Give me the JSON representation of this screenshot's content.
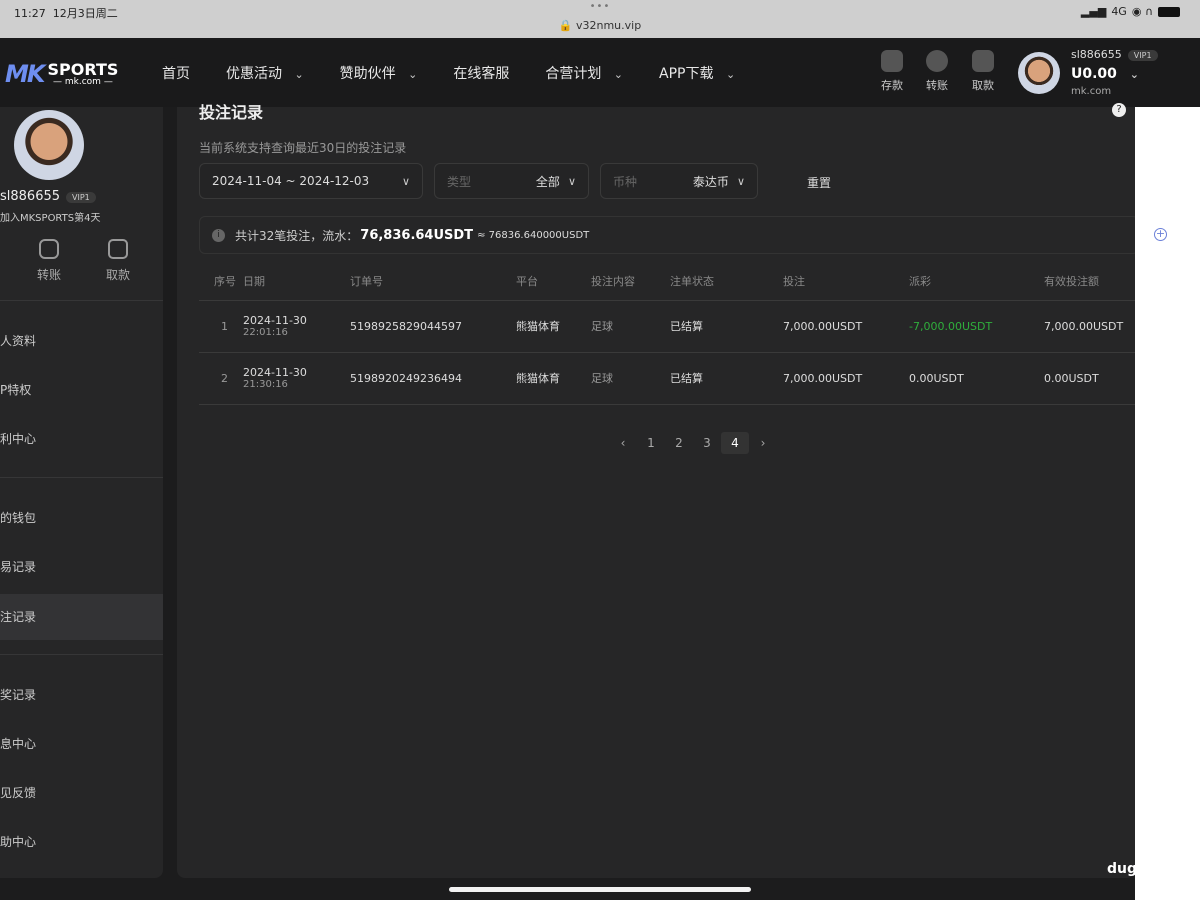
{
  "status_bar": {
    "time": "11:27",
    "date": "12月3日周二",
    "url": "v32nmu.vip",
    "network": "4G"
  },
  "nav": {
    "logo_mk": "MK",
    "logo_sports": "SPORTS",
    "logo_domain": "— mk.com —",
    "menu": [
      "首页",
      "优惠活动",
      "赞助伙伴",
      "在线客服",
      "合营计划",
      "APP下载"
    ],
    "actions": [
      "存款",
      "转账",
      "取款"
    ],
    "user": {
      "name": "sl886655",
      "vip": "VIP1",
      "balance": "U0.00",
      "domain": "mk.com"
    }
  },
  "sidebar": {
    "name": "sl886655",
    "vip": "VIP1",
    "joined": "加入MKSPORTS第4天",
    "actions": [
      "转账",
      "取款"
    ],
    "items": [
      "人资料",
      "P特权",
      "利中心",
      "的钱包",
      "易记录",
      "注记录",
      "奖记录",
      "息中心",
      "见反馈",
      "助中心"
    ],
    "active_index": 5
  },
  "main": {
    "title": "投注记录",
    "hint": "当前系统支持查询最近30日的投注记录",
    "filters": {
      "date_range": "2024-11-04 ~ 2024-12-03",
      "type_label": "类型",
      "type_value": "全部",
      "currency_label": "币种",
      "currency_value": "泰达币",
      "reset": "重置"
    },
    "summary": {
      "prefix": "共计32笔投注，流水：",
      "amount": "76,836.64USDT",
      "approx": "≈ 76836.640000USDT"
    },
    "columns": [
      "序号",
      "日期",
      "订单号",
      "平台",
      "投注内容",
      "注单状态",
      "投注",
      "派彩",
      "有效投注额"
    ],
    "rows": [
      {
        "no": "1",
        "date": "2024-11-30",
        "time": "22:01:16",
        "order": "5198925829044597",
        "platform": "熊猫体育",
        "content": "足球",
        "status": "已结算",
        "bet": "7,000.00USDT",
        "payout": "-7,000.00USDT",
        "valid": "7,000.00USDT"
      },
      {
        "no": "2",
        "date": "2024-11-30",
        "time": "21:30:16",
        "order": "5198920249236494",
        "platform": "熊猫体育",
        "content": "足球",
        "status": "已结算",
        "bet": "7,000.00USDT",
        "payout": "0.00USDT",
        "valid": "0.00USDT"
      }
    ],
    "pager": {
      "pages": [
        "1",
        "2",
        "3",
        "4"
      ],
      "current": "4"
    }
  },
  "watermark": "dug",
  "colors": {
    "accent": "#6e8ef0",
    "negative_payout": "#2fae3c"
  }
}
